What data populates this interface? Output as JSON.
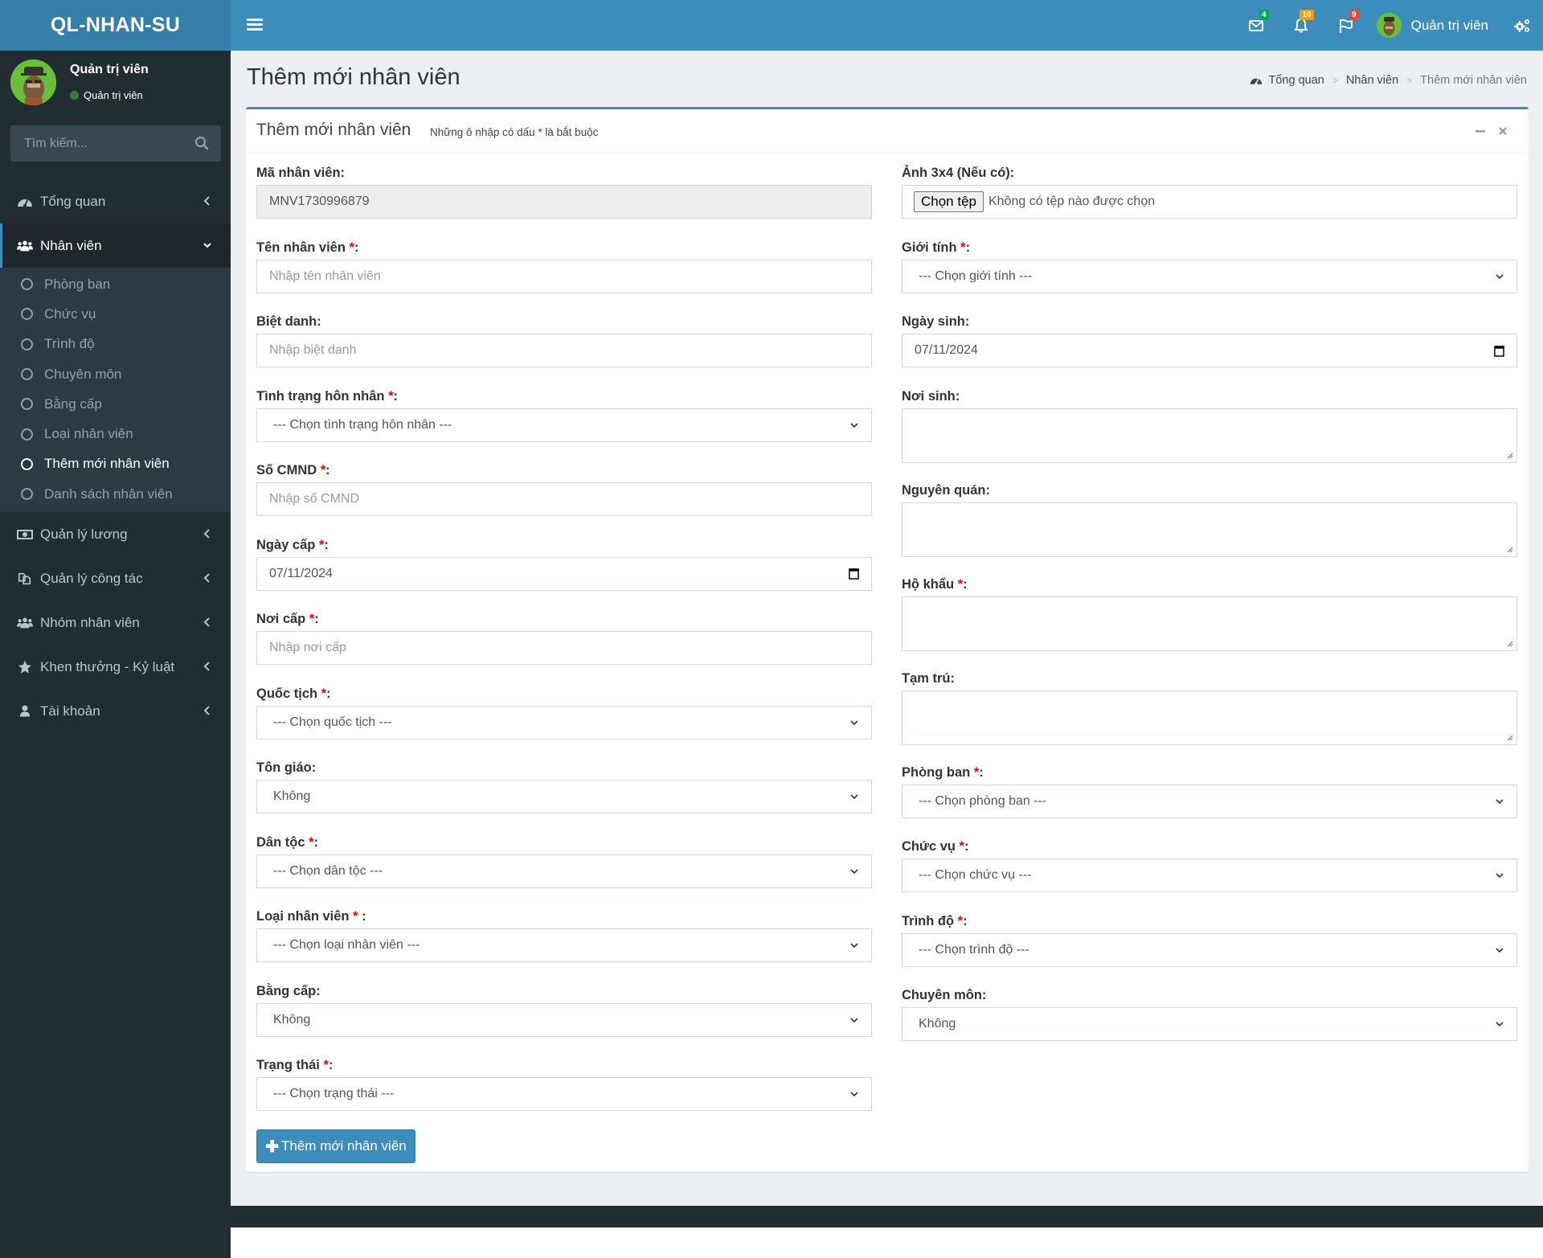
{
  "app": {
    "logo": "QL-NHAN-SU"
  },
  "navbar": {
    "messages_badge": "4",
    "notifications_badge": "10",
    "tasks_badge": "9",
    "user_name": "Quản trị viên",
    "colors": {
      "messages": "#00a65a",
      "notifications": "#f39c12",
      "tasks": "#dd4b39"
    }
  },
  "sidebar": {
    "user_name": "Quản trị viên",
    "user_status": "Quản trị viên",
    "search_placeholder": "Tìm kiếm...",
    "menu": [
      {
        "label": "Tổng quan",
        "icon": "dashboard-icon"
      },
      {
        "label": "Nhân viên",
        "icon": "users-icon",
        "active": true,
        "children": [
          {
            "label": "Phòng ban"
          },
          {
            "label": "Chức vụ"
          },
          {
            "label": "Trình độ"
          },
          {
            "label": "Chuyên môn"
          },
          {
            "label": "Bằng cấp"
          },
          {
            "label": "Loại nhân viên"
          },
          {
            "label": "Thêm mới nhân viên",
            "active": true
          },
          {
            "label": "Danh sách nhân viên"
          }
        ]
      },
      {
        "label": "Quản lý lương",
        "icon": "money-icon"
      },
      {
        "label": "Quản lý công tác",
        "icon": "copy-icon"
      },
      {
        "label": "Nhóm nhân viên",
        "icon": "users-icon"
      },
      {
        "label": "Khen thưởng - Kỷ luật",
        "icon": "star-icon"
      },
      {
        "label": "Tài khoản",
        "icon": "user-icon"
      }
    ]
  },
  "page": {
    "title": "Thêm mới nhân viên",
    "breadcrumb": [
      "Tổng quan",
      "Nhân viên",
      "Thêm mới nhân viên"
    ]
  },
  "box": {
    "title": "Thêm mới nhân viên",
    "hint_before": "Những ô nhập có dấu ",
    "hint_star": "*",
    "hint_after": " là bắt buộc"
  },
  "form": {
    "left": [
      {
        "label": "Mã nhân viên:",
        "required": false,
        "type": "readonly",
        "value": "MNV1730996879"
      },
      {
        "label": "Tên nhân viên ",
        "required": true,
        "type": "text",
        "placeholder": "Nhập tên nhân viên"
      },
      {
        "label": "Biệt danh:",
        "required": false,
        "type": "text",
        "placeholder": "Nhập biệt danh"
      },
      {
        "label": "Tình trạng hôn nhân ",
        "required": true,
        "type": "select",
        "value": "--- Chọn tình trạng hôn nhân ---"
      },
      {
        "label": "Số CMND ",
        "required": true,
        "type": "text",
        "placeholder": "Nhập số CMND"
      },
      {
        "label": "Ngày cấp ",
        "required": true,
        "type": "date",
        "value": "07/11/2024"
      },
      {
        "label": "Nơi cấp ",
        "required": true,
        "type": "text",
        "placeholder": "Nhập nơi cấp"
      },
      {
        "label": "Quốc tịch ",
        "required": true,
        "type": "select",
        "value": "--- Chọn quốc tịch ---"
      },
      {
        "label": "Tôn giáo:",
        "required": false,
        "type": "select",
        "value": "Không"
      },
      {
        "label": "Dân tộc ",
        "required": true,
        "type": "select",
        "value": "--- Chọn dân tộc ---"
      },
      {
        "label": "Loại nhân viên ",
        "required": true,
        "suffix": " :",
        "type": "select",
        "value": "--- Chọn loại nhân viên ---"
      },
      {
        "label": "Bằng cấp:",
        "required": false,
        "type": "select",
        "value": "Không"
      },
      {
        "label": "Trạng thái ",
        "required": true,
        "type": "select",
        "value": "--- Chọn trạng thái ---"
      }
    ],
    "right": [
      {
        "label": "Ảnh 3x4 (Nếu có):",
        "required": false,
        "type": "file",
        "button": "Chọn tệp",
        "value": "Không có tệp nào được chọn"
      },
      {
        "label": "Giới tính ",
        "required": true,
        "type": "select",
        "value": "--- Chọn giới tính ---"
      },
      {
        "label": "Ngày sinh:",
        "required": false,
        "type": "date",
        "value": "07/11/2024"
      },
      {
        "label": "Nơi sinh:",
        "required": false,
        "type": "textarea",
        "value": ""
      },
      {
        "label": "Nguyên quán:",
        "required": false,
        "type": "textarea",
        "value": ""
      },
      {
        "label": "Hộ khẩu ",
        "required": true,
        "type": "textarea",
        "value": ""
      },
      {
        "label": "Tạm trú:",
        "required": false,
        "type": "textarea",
        "value": ""
      },
      {
        "label": "Phòng ban ",
        "required": true,
        "type": "select",
        "value": "--- Chọn phòng ban ---"
      },
      {
        "label": "Chức vụ ",
        "required": true,
        "type": "select",
        "value": "--- Chọn chức vụ ---"
      },
      {
        "label": "Trình độ ",
        "required": true,
        "type": "select",
        "value": "--- Chọn trình độ ---"
      },
      {
        "label": "Chuyên môn:",
        "required": false,
        "type": "select",
        "value": "Không"
      }
    ],
    "submit_label": "Thêm mới nhân viên"
  }
}
